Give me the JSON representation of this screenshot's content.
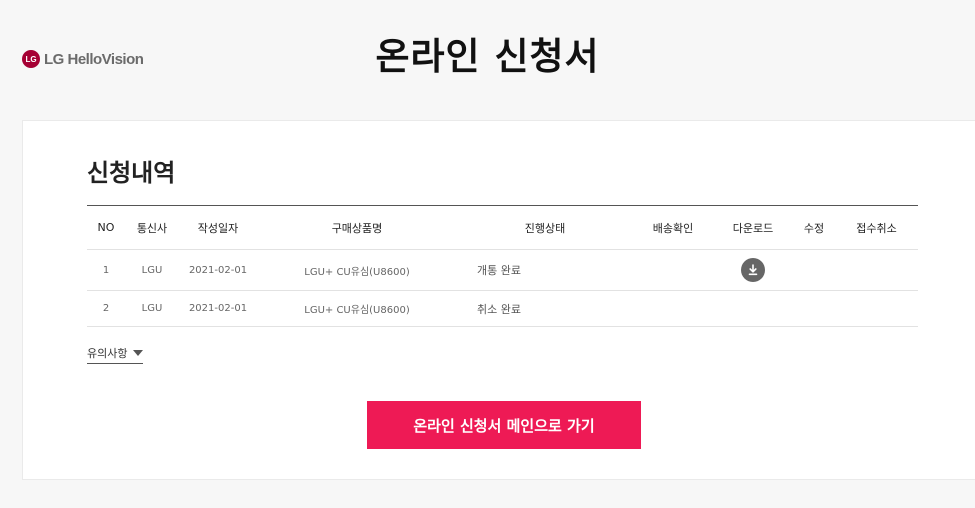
{
  "header": {
    "logo_mark": "LG",
    "logo_text": "LG HelloVision",
    "title": "온라인 신청서"
  },
  "section": {
    "title": "신청내역"
  },
  "table": {
    "columns": [
      "NO",
      "통신사",
      "작성일자",
      "구매상품명",
      "진행상태",
      "배송확인",
      "다운로드",
      "수정",
      "접수취소"
    ],
    "rows": [
      {
        "no": "1",
        "carrier": "LGU",
        "date": "2021-02-01",
        "product": "LGU+ CU유심(U8600)",
        "status": "개통 완료",
        "delivery": "",
        "download": "download-icon",
        "edit": "",
        "cancel": ""
      },
      {
        "no": "2",
        "carrier": "LGU",
        "date": "2021-02-01",
        "product": "LGU+ CU유심(U8600)",
        "status": "취소 완료",
        "delivery": "",
        "download": "",
        "edit": "",
        "cancel": ""
      }
    ]
  },
  "notice": {
    "label": "유의사항"
  },
  "main_button": {
    "label": "온라인 신청서 메인으로 가기"
  },
  "colors": {
    "accent": "#ee1a55",
    "brand": "#a50034",
    "download_icon_bg": "#666666"
  }
}
